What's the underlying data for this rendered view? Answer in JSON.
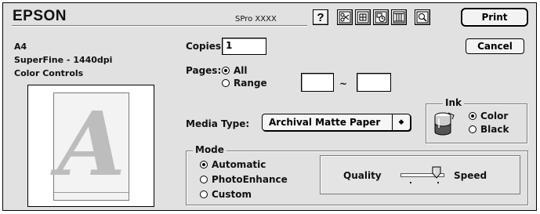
{
  "header": {
    "brand": "EPSON",
    "model": "SPro XXXX",
    "toolbar": [
      {
        "name": "help-button",
        "icon": "question-mark-icon"
      },
      {
        "name": "custom-settings-button",
        "icon": "scissors-layout-icon"
      },
      {
        "name": "layout-button",
        "icon": "layout-grid-icon"
      },
      {
        "name": "background-print-button",
        "icon": "printer-clock-icon"
      },
      {
        "name": "utility-button",
        "icon": "utility-columns-icon"
      },
      {
        "name": "preview-button",
        "icon": "magnifier-page-icon"
      }
    ],
    "print_label": "Print",
    "cancel_label": "Cancel"
  },
  "summary": {
    "paper_size": "A4",
    "resolution": "SuperFine - 1440dpi",
    "color_mode": "Color Controls",
    "preview_letter": "A"
  },
  "copies": {
    "label": "Copies:",
    "value": "1"
  },
  "pages": {
    "label": "Pages:",
    "options": [
      "All",
      "Range"
    ],
    "selected": "All",
    "range_separator": "~",
    "range_from": "",
    "range_to": ""
  },
  "ink": {
    "title": "Ink",
    "options": [
      "Color",
      "Black"
    ],
    "selected": "Color"
  },
  "media": {
    "label": "Media Type:",
    "value": "Archival Matte Paper",
    "arrow": "◆"
  },
  "mode": {
    "title": "Mode",
    "options": [
      "Automatic",
      "PhotoEnhance",
      "Custom"
    ],
    "selected": "Automatic",
    "quality_label": "Quality",
    "speed_label": "Speed",
    "slider_position": 0.85
  }
}
